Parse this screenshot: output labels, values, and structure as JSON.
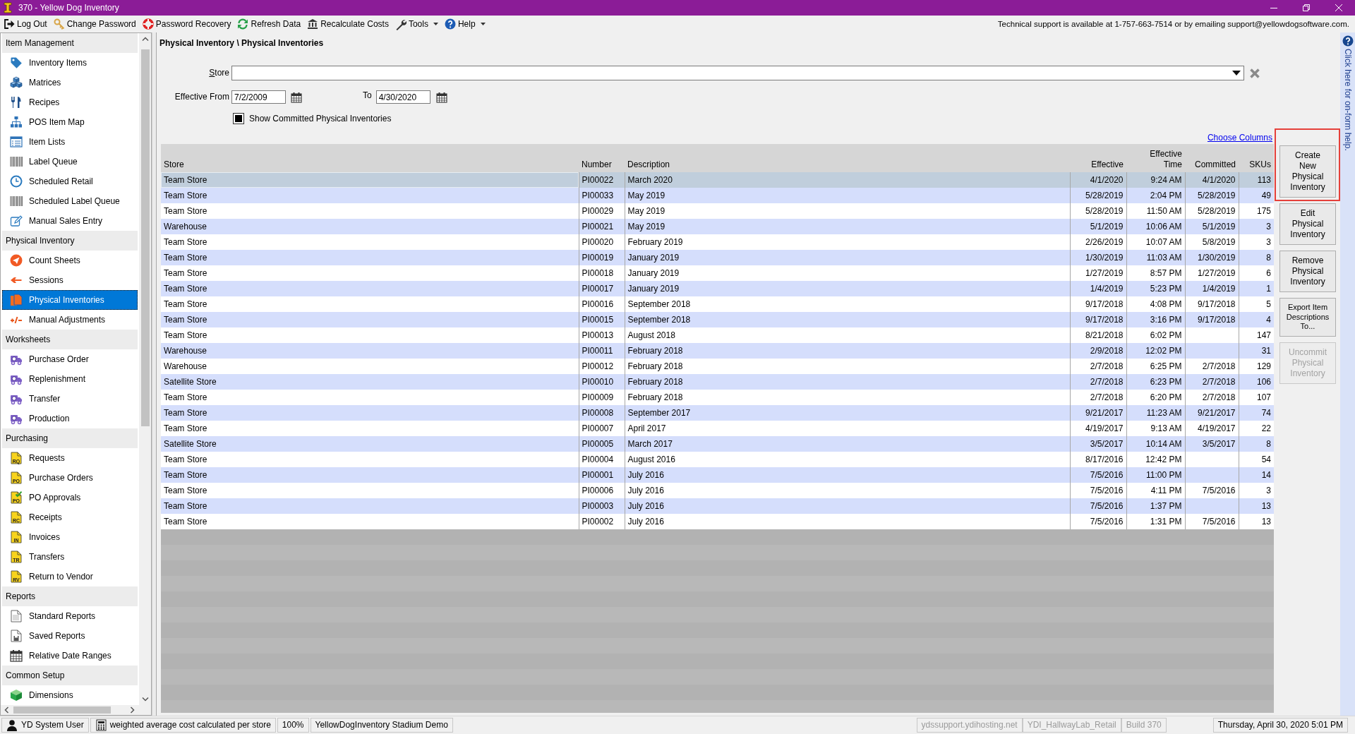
{
  "window": {
    "title": "370 - Yellow Dog Inventory"
  },
  "toolbar": {
    "items": [
      {
        "label": "Log Out",
        "dropdown": false
      },
      {
        "label": "Change Password",
        "dropdown": false
      },
      {
        "label": "Password Recovery",
        "dropdown": false
      },
      {
        "label": "Refresh Data",
        "dropdown": false
      },
      {
        "label": "Recalculate Costs",
        "dropdown": false
      },
      {
        "label": "Tools",
        "dropdown": true
      },
      {
        "label": "Help",
        "dropdown": true
      }
    ],
    "support_text": "Technical support is available at 1-757-663-7514 or by emailing support@yellowdogsoftware.com."
  },
  "sidebar": {
    "sections": [
      {
        "title": "Item Management",
        "items": [
          {
            "label": "Inventory Items",
            "selected": false
          },
          {
            "label": "Matrices",
            "selected": false
          },
          {
            "label": "Recipes",
            "selected": false
          },
          {
            "label": "POS Item Map",
            "selected": false
          },
          {
            "label": "Item Lists",
            "selected": false
          },
          {
            "label": "Label Queue",
            "selected": false
          },
          {
            "label": "Scheduled Retail",
            "selected": false
          },
          {
            "label": "Scheduled Label Queue",
            "selected": false
          },
          {
            "label": "Manual Sales Entry",
            "selected": false
          }
        ]
      },
      {
        "title": "Physical Inventory",
        "items": [
          {
            "label": "Count Sheets",
            "selected": false
          },
          {
            "label": "Sessions",
            "selected": false
          },
          {
            "label": "Physical Inventories",
            "selected": true
          },
          {
            "label": "Manual Adjustments",
            "selected": false
          }
        ]
      },
      {
        "title": "Worksheets",
        "items": [
          {
            "label": "Purchase Order",
            "selected": false
          },
          {
            "label": "Replenishment",
            "selected": false
          },
          {
            "label": "Transfer",
            "selected": false
          },
          {
            "label": "Production",
            "selected": false
          }
        ]
      },
      {
        "title": "Purchasing",
        "items": [
          {
            "label": "Requests",
            "icon_text": "RQ",
            "selected": false
          },
          {
            "label": "Purchase Orders",
            "icon_text": "PO",
            "selected": false
          },
          {
            "label": "PO Approvals",
            "icon_text": "PO",
            "selected": false
          },
          {
            "label": "Receipts",
            "icon_text": "RC",
            "selected": false
          },
          {
            "label": "Invoices",
            "icon_text": "IN",
            "selected": false
          },
          {
            "label": "Transfers",
            "icon_text": "TR",
            "selected": false
          },
          {
            "label": "Return to Vendor",
            "icon_text": "RV",
            "selected": false
          }
        ]
      },
      {
        "title": "Reports",
        "items": [
          {
            "label": "Standard Reports",
            "selected": false
          },
          {
            "label": "Saved Reports",
            "selected": false
          },
          {
            "label": "Relative Date Ranges",
            "selected": false
          }
        ]
      },
      {
        "title": "Common Setup",
        "items": [
          {
            "label": "Dimensions",
            "selected": false
          }
        ]
      }
    ]
  },
  "breadcrumb": "Physical Inventory \\ Physical Inventories",
  "filters": {
    "store": {
      "label": "Store"
    },
    "effective_from": {
      "label": "Effective From",
      "value": "7/2/2009"
    },
    "effective_to": {
      "label": "To",
      "value": "4/30/2020"
    },
    "show_committed": {
      "label": "Show Committed Physical Inventories",
      "checked": true
    }
  },
  "choose_columns": "Choose Columns",
  "table": {
    "columns": [
      "Store",
      "Number",
      "Description",
      "Effective",
      "Effective Time",
      "Committed",
      "SKUs"
    ],
    "rows": [
      {
        "selected": true,
        "store": "Team Store",
        "number": "PI00022",
        "description": "March 2020",
        "effective": "4/1/2020",
        "effective_time": "9:24 AM",
        "committed": "4/1/2020",
        "skus": "113"
      },
      {
        "selected": false,
        "store": "Team Store",
        "number": "PI00033",
        "description": "May 2019",
        "effective": "5/28/2019",
        "effective_time": "2:04 PM",
        "committed": "5/28/2019",
        "skus": "49"
      },
      {
        "selected": false,
        "store": "Team Store",
        "number": "PI00029",
        "description": "May 2019",
        "effective": "5/28/2019",
        "effective_time": "11:50 AM",
        "committed": "5/28/2019",
        "skus": "175"
      },
      {
        "selected": false,
        "store": "Warehouse",
        "number": "PI00021",
        "description": "May 2019",
        "effective": "5/1/2019",
        "effective_time": "10:06 AM",
        "committed": "5/1/2019",
        "skus": "3"
      },
      {
        "selected": false,
        "store": "Team Store",
        "number": "PI00020",
        "description": "February 2019",
        "effective": "2/26/2019",
        "effective_time": "10:07 AM",
        "committed": "5/8/2019",
        "skus": "3"
      },
      {
        "selected": false,
        "store": "Team Store",
        "number": "PI00019",
        "description": "January 2019",
        "effective": "1/30/2019",
        "effective_time": "11:03 AM",
        "committed": "1/30/2019",
        "skus": "8"
      },
      {
        "selected": false,
        "store": "Team Store",
        "number": "PI00018",
        "description": "January 2019",
        "effective": "1/27/2019",
        "effective_time": "8:57 PM",
        "committed": "1/27/2019",
        "skus": "6"
      },
      {
        "selected": false,
        "store": "Team Store",
        "number": "PI00017",
        "description": "January 2019",
        "effective": "1/4/2019",
        "effective_time": "5:23 PM",
        "committed": "1/4/2019",
        "skus": "1"
      },
      {
        "selected": false,
        "store": "Team Store",
        "number": "PI00016",
        "description": "September 2018",
        "effective": "9/17/2018",
        "effective_time": "4:08 PM",
        "committed": "9/17/2018",
        "skus": "5"
      },
      {
        "selected": false,
        "store": "Team Store",
        "number": "PI00015",
        "description": "September 2018",
        "effective": "9/17/2018",
        "effective_time": "3:16 PM",
        "committed": "9/17/2018",
        "skus": "4"
      },
      {
        "selected": false,
        "store": "Team Store",
        "number": "PI00013",
        "description": "August 2018",
        "effective": "8/21/2018",
        "effective_time": "6:02 PM",
        "skus": "147"
      },
      {
        "selected": false,
        "store": "Warehouse",
        "number": "PI00011",
        "description": "February 2018",
        "effective": "2/9/2018",
        "effective_time": "12:02 PM",
        "skus": "31"
      },
      {
        "selected": false,
        "store": "Warehouse",
        "number": "PI00012",
        "description": "February 2018",
        "effective": "2/7/2018",
        "effective_time": "6:25 PM",
        "committed": "2/7/2018",
        "skus": "129"
      },
      {
        "selected": false,
        "store": "Satellite Store",
        "number": "PI00010",
        "description": "February 2018",
        "effective": "2/7/2018",
        "effective_time": "6:23 PM",
        "committed": "2/7/2018",
        "skus": "106"
      },
      {
        "selected": false,
        "store": "Team Store",
        "number": "PI00009",
        "description": "February 2018",
        "effective": "2/7/2018",
        "effective_time": "6:20 PM",
        "committed": "2/7/2018",
        "skus": "107"
      },
      {
        "selected": false,
        "store": "Team Store",
        "number": "PI00008",
        "description": "September 2017",
        "effective": "9/21/2017",
        "effective_time": "11:23 AM",
        "committed": "9/21/2017",
        "skus": "74"
      },
      {
        "selected": false,
        "store": "Team Store",
        "number": "PI00007",
        "description": "April 2017",
        "effective": "4/19/2017",
        "effective_time": "9:13 AM",
        "committed": "4/19/2017",
        "skus": "22"
      },
      {
        "selected": false,
        "store": "Satellite Store",
        "number": "PI00005",
        "description": "March 2017",
        "effective": "3/5/2017",
        "effective_time": "10:14 AM",
        "committed": "3/5/2017",
        "skus": "8"
      },
      {
        "selected": false,
        "store": "Team Store",
        "number": "PI00004",
        "description": "August 2016",
        "effective": "8/17/2016",
        "effective_time": "12:42 PM",
        "skus": "54"
      },
      {
        "selected": false,
        "store": "Team Store",
        "number": "PI00001",
        "description": "July 2016",
        "effective": "7/5/2016",
        "effective_time": "11:00 PM",
        "skus": "14"
      },
      {
        "selected": false,
        "store": "Team Store",
        "number": "PI00006",
        "description": "July 2016",
        "effective": "7/5/2016",
        "effective_time": "4:11 PM",
        "committed": "7/5/2016",
        "skus": "3"
      },
      {
        "selected": false,
        "store": "Team Store",
        "number": "PI00003",
        "description": "July 2016",
        "effective": "7/5/2016",
        "effective_time": "1:37 PM",
        "skus": "13"
      },
      {
        "selected": false,
        "store": "Team Store",
        "number": "PI00002",
        "description": "July 2016",
        "effective": "7/5/2016",
        "effective_time": "1:31 PM",
        "committed": "7/5/2016",
        "skus": "13"
      }
    ]
  },
  "actions": [
    {
      "label": "Create New Physical Inventory",
      "disabled": false,
      "highlighted": true
    },
    {
      "label": "Edit Physical Inventory",
      "disabled": false,
      "highlighted": false
    },
    {
      "label": "Remove Physical Inventory",
      "disabled": false,
      "highlighted": false
    },
    {
      "label": "Export Item Descriptions To...",
      "disabled": false,
      "highlighted": false
    },
    {
      "label": "Uncommit Physical Inventory",
      "disabled": true,
      "highlighted": false
    }
  ],
  "help_panel": {
    "text": "Click here for on-form help."
  },
  "status_bar": {
    "left": [
      {
        "text": "YD System User",
        "disabled": false
      },
      {
        "text": "weighted average cost calculated per store",
        "disabled": false
      },
      {
        "text": "100%",
        "disabled": false
      },
      {
        "text": "YellowDogInventory Stadium Demo",
        "disabled": false
      }
    ],
    "right": [
      {
        "text": "ydssupport.ydihosting.net",
        "disabled": true
      },
      {
        "text": "YDI_HallwayLab_Retail",
        "disabled": true
      },
      {
        "text": "Build 370",
        "disabled": true
      }
    ],
    "clock": "Thursday, April 30, 2020 5:01 PM"
  }
}
